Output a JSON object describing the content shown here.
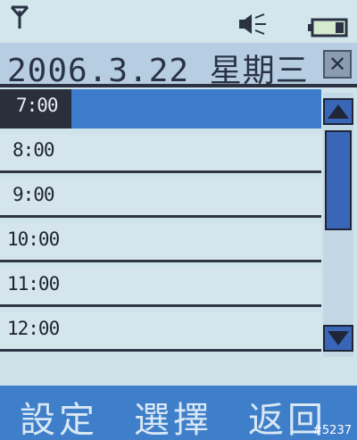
{
  "status": {
    "signal_icon": "antenna-icon",
    "sound_icon": "speaker-muted-icon",
    "battery_icon": "battery-icon"
  },
  "header": {
    "date": "2006.3.22 星期三",
    "close_label": "✕"
  },
  "time_slots": [
    {
      "label": "7:00"
    },
    {
      "label": "8:00"
    },
    {
      "label": "9:00"
    },
    {
      "label": "10:00"
    },
    {
      "label": "11:00"
    },
    {
      "label": "12:00"
    }
  ],
  "softkeys": {
    "left": "設定",
    "center": "選擇",
    "right": "返回"
  },
  "watermark": "#5237",
  "colors": {
    "accent": "#3d7ccc",
    "selected_time_bg": "#2a2f3c",
    "background": "#cfe3ea"
  }
}
